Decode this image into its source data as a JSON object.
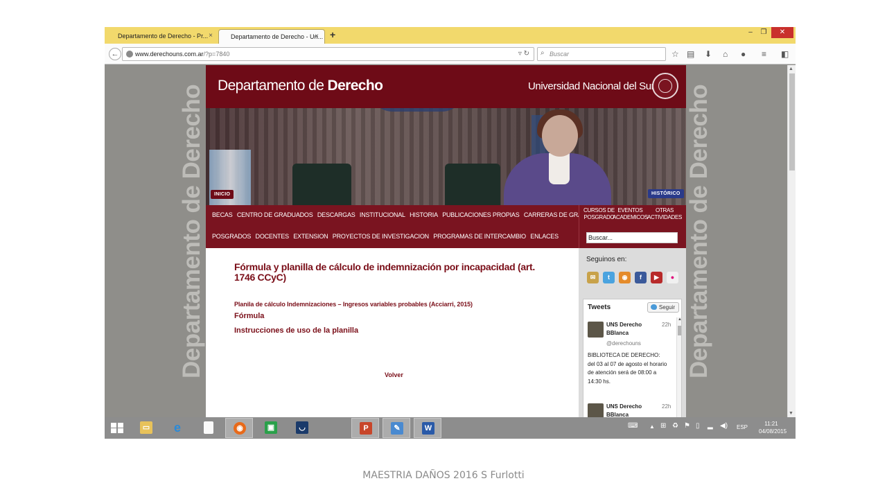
{
  "browser": {
    "tabs": [
      {
        "label": "Departamento de Derecho - Pr..."
      },
      {
        "label": "Departamento de Derecho - Un..."
      }
    ],
    "new_tab": "+",
    "close_glyph": "×",
    "url_domain": "www.derechouns.com.ar",
    "url_path": "/?p=7840",
    "search_placeholder": "Buscar",
    "min_glyph": "–",
    "max_glyph": "❐",
    "close_window_glyph": "✕"
  },
  "site": {
    "title_light": "Departamento de ",
    "title_bold": "Derecho",
    "university": "Universidad Nacional del Sur",
    "side_text": "Departamento de Derecho",
    "badge_inicio": "INICIO",
    "badge_historico": "HISTÓRICO",
    "menu_row1": [
      "BECAS",
      "CENTRO DE GRADUADOS",
      "DESCARGAS",
      "INSTITUCIONAL",
      "HISTORIA",
      "PUBLICACIONES PROPIAS",
      "CARRERAS DE GRADO"
    ],
    "menu_row2": [
      "POSGRADOS",
      "DOCENTES",
      "EXTENSION",
      "PROYECTOS DE INVESTIGACION",
      "PROGRAMAS DE INTERCAMBIO",
      "ENLACES"
    ],
    "menu_right": [
      {
        "line1": "CURSOS DE",
        "line2": "POSGRADO"
      },
      {
        "line1": "EVENTOS",
        "line2": "ACADEMICOS"
      },
      {
        "line1": "OTRAS",
        "line2": "ACTIVIDADES"
      }
    ],
    "search_value": "Buscar..."
  },
  "article": {
    "title": "Fórmula y planilla de cálculo de indemnización por incapacidad (art. 1746 CCyC)",
    "subtitle": "Planila de cálculo Indemnizaciones – Ingresos variables probables (Acciarri, 2015)",
    "link_formula": "Fórmula",
    "link_instructions": "Instrucciones de uso de la planilla",
    "back": "Volver"
  },
  "sidebar": {
    "follow_label": "Seguinos en:",
    "social_icons": [
      "email-icon",
      "twitter-icon",
      "rss-icon",
      "facebook-icon",
      "youtube-icon",
      "flickr-icon"
    ],
    "tweets_title": "Tweets",
    "follow_button": "Seguir",
    "tweets": [
      {
        "name": "UNS Derecho BBlanca",
        "handle": "@derechouns",
        "time": "22h",
        "text": "BIBLIOTECA DE DERECHO: del 03 al 07 de agosto el horario de atención será de 08:00 a 14:30 hs."
      },
      {
        "name": "UNS Derecho BBlanca",
        "time": "22h"
      }
    ]
  },
  "taskbar": {
    "language": "ESP",
    "time": "11:21",
    "date": "04/08/2015"
  },
  "footer": {
    "text": "MAESTRIA DAÑOS 2016 S Furlotti"
  },
  "colors": {
    "brand_maroon": "#6e0b17",
    "menu_maroon": "#7a1420",
    "tab_yellow": "#f2d96c",
    "taskbar_gray": "#8d8d8d"
  }
}
